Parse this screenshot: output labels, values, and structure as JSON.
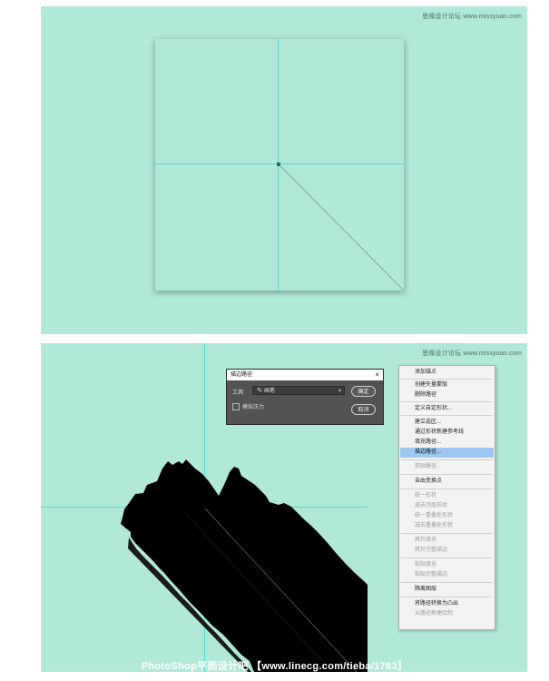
{
  "watermark": "思缘设计论坛 www.missyuan.com",
  "dialog": {
    "title": "描边路径",
    "close_label": "×",
    "tool_label": "工具:",
    "tool_value": "画笔",
    "simulate_pressure_label": "模拟压力",
    "ok_label": "确定",
    "cancel_label": "取消"
  },
  "context_menu": {
    "items": [
      {
        "label": "添加锚点",
        "state": "enabled"
      },
      {
        "label": "创建矢量蒙版",
        "state": "enabled"
      },
      {
        "label": "删除路径",
        "state": "enabled"
      },
      {
        "label": "定义自定形状...",
        "state": "enabled"
      },
      {
        "label": "建立选区...",
        "state": "enabled"
      },
      {
        "label": "通过形状新建参考线",
        "state": "enabled"
      },
      {
        "label": "填充路径...",
        "state": "enabled"
      },
      {
        "label": "描边路径...",
        "state": "highlighted"
      },
      {
        "label": "剪贴路径...",
        "state": "disabled"
      },
      {
        "label": "自由变换点",
        "state": "enabled"
      },
      {
        "label": "统一形状",
        "state": "disabled"
      },
      {
        "label": "减去顶层形状",
        "state": "disabled"
      },
      {
        "label": "统一重叠处形状",
        "state": "disabled"
      },
      {
        "label": "减去重叠处形状",
        "state": "disabled"
      },
      {
        "label": "拷贝填充",
        "state": "disabled"
      },
      {
        "label": "拷贝完整描边",
        "state": "disabled"
      },
      {
        "label": "粘贴填充",
        "state": "disabled"
      },
      {
        "label": "粘贴完整描边",
        "state": "disabled"
      },
      {
        "label": "隔离图层",
        "state": "enabled"
      },
      {
        "label": "将路径转换为凸出",
        "state": "enabled"
      },
      {
        "label": "从路径新建绘制",
        "state": "disabled"
      }
    ]
  },
  "footer_banner": "PhotoShop平面设计吧 【www.linecg.com/tieba/1783】",
  "colors": {
    "background": "#b2e8d8",
    "guide": "#4fdcd6",
    "menu_highlight": "#9dc7f0"
  }
}
